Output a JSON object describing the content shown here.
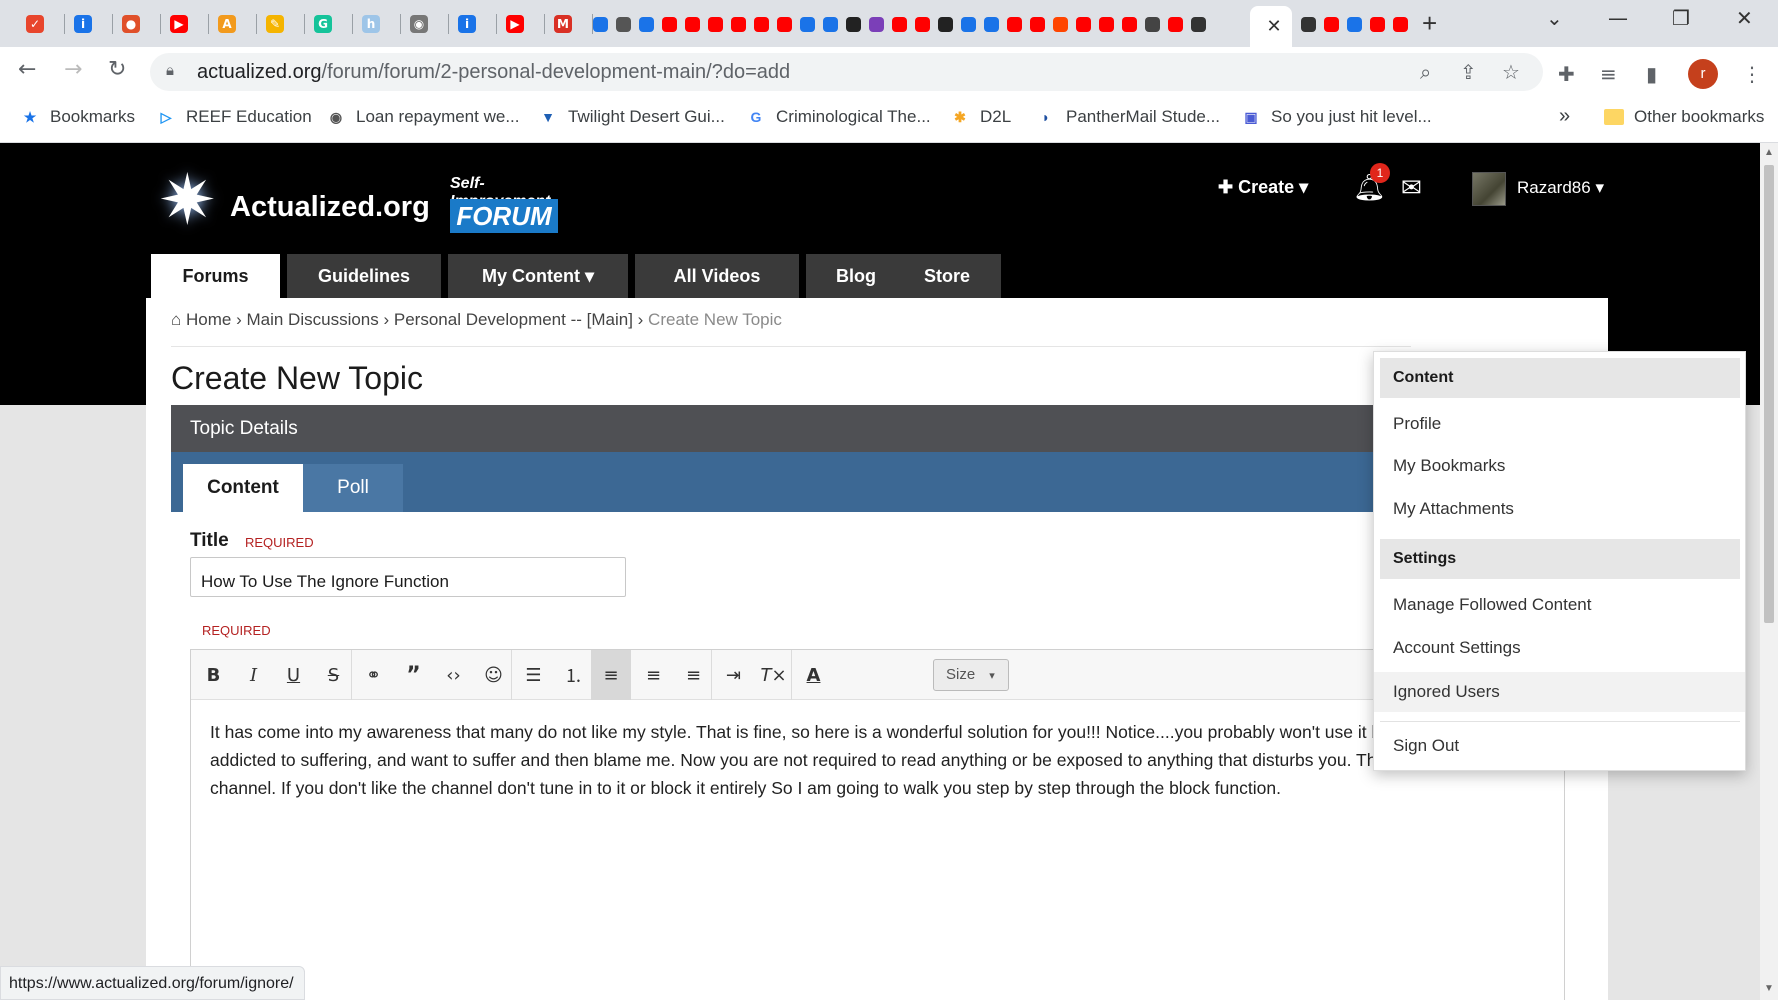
{
  "browser": {
    "tabs": [
      {
        "icon": "scribd-icon",
        "color": "#e8452c",
        "glyph": "✓"
      },
      {
        "icon": "info-icon",
        "color": "#1a73e8",
        "glyph": "i"
      },
      {
        "icon": "podcast-icon",
        "color": "#e0502a",
        "glyph": "●"
      },
      {
        "icon": "youtube-icon",
        "color": "#ff0000",
        "glyph": "▶"
      },
      {
        "icon": "audible-icon",
        "color": "#f29a1d",
        "glyph": "A"
      },
      {
        "icon": "pencil-icon",
        "color": "#f5b400",
        "glyph": "✎"
      },
      {
        "icon": "grammarly-icon",
        "color": "#15c39a",
        "glyph": "G"
      },
      {
        "icon": "hinge-icon",
        "color": "#9ec5e8",
        "glyph": "h"
      },
      {
        "icon": "globe-icon",
        "color": "#777777",
        "glyph": "◉"
      },
      {
        "icon": "info-icon",
        "color": "#1a73e8",
        "glyph": "i"
      },
      {
        "icon": "youtube-icon",
        "color": "#ff0000",
        "glyph": "▶"
      },
      {
        "icon": "gmail-icon",
        "color": "#d93025",
        "glyph": "M"
      }
    ],
    "minitab_colors": [
      "#1a73e8",
      "#555555",
      "#1a73e8",
      "#ff0000",
      "#ff0000",
      "#ff0000",
      "#ff0000",
      "#ff0000",
      "#ff0000",
      "#1a73e8",
      "#1a73e8",
      "#222222",
      "#7b3fb8",
      "#ff0000",
      "#ff0000",
      "#222222",
      "#1a73e8",
      "#1a73e8",
      "#ff0000",
      "#ff0000",
      "#ff4500",
      "#ff0000",
      "#ff0000",
      "#ff0000",
      "#444444",
      "#ff0000",
      "#333333"
    ],
    "active_tab": {
      "icon": "close-icon",
      "glyph": "✕"
    },
    "after_active_colors": [
      "#333333",
      "#ff0000",
      "#1a73e8",
      "#ff0000",
      "#ff0000"
    ],
    "new_tab_glyph": "+",
    "window_controls": {
      "dropdown": "⌄",
      "minimize": "—",
      "restore": "❐",
      "close": "✕"
    },
    "url_host": "actualized.org",
    "url_path": "/forum/forum/2-personal-development-main/?do=add",
    "profile_initial": "r",
    "bookmarks": [
      {
        "label": "Bookmarks",
        "icon": "star-icon",
        "glyph": "★",
        "color": "#1a73e8"
      },
      {
        "label": "REEF Education",
        "icon": "reef-icon",
        "glyph": "▷",
        "color": "#2196f3"
      },
      {
        "label": "Loan repayment we...",
        "icon": "globe-icon",
        "glyph": "◉",
        "color": "#555555"
      },
      {
        "label": "Twilight Desert Gui...",
        "icon": "twilight-icon",
        "glyph": "▼",
        "color": "#1e5fb4"
      },
      {
        "label": "Criminological The...",
        "icon": "google-icon",
        "glyph": "G",
        "color": "#4285f4"
      },
      {
        "label": "D2L",
        "icon": "d2l-icon",
        "glyph": "✱",
        "color": "#f5a623"
      },
      {
        "label": "PantherMail Stude...",
        "icon": "panther-icon",
        "glyph": "◗",
        "color": "#1e4fa0"
      },
      {
        "label": "So you just hit level...",
        "icon": "level-icon",
        "glyph": "▣",
        "color": "#4a5bd4"
      }
    ],
    "bookmarks_overflow": "»",
    "other_bookmarks": "Other bookmarks",
    "status_url": "https://www.actualized.org/forum/ignore/"
  },
  "site": {
    "logo_name": "Actualized.org",
    "logo_tagline": "Self-Improvement",
    "logo_forum": "FORUM",
    "create_label": "Create",
    "notification_count": "1",
    "username": "Razard86",
    "nav_tabs": [
      "Forums",
      "Guidelines",
      "My Content",
      "All Videos",
      "Blog",
      "Store"
    ],
    "breadcrumb": [
      "Home",
      "Main Discussions",
      "Personal Development -- [Main]",
      "Create New Topic"
    ],
    "page_title": "Create New Topic",
    "topic_details": "Topic Details",
    "content_tabs": [
      "Content",
      "Poll"
    ],
    "title_label": "Title",
    "required_label": "REQUIRED",
    "title_value": "How To Use The Ignore Function",
    "size_label": "Size",
    "body_text": "It has come into my awareness that many do not like my style. That is fine, so here is a wonderful solution for you!!! Notice....you probably won't use it because you are addicted to suffering, and want to suffer and then blame me. Now you are not required to read anything or be exposed to anything that disturbs you. Think of my posts as a channel. If you don't like the channel don't tune in to it or block it entirely So I am going to walk you step by step through the block function."
  },
  "user_menu": {
    "content_heading": "Content",
    "content_items": [
      "Profile",
      "My Bookmarks",
      "My Attachments"
    ],
    "settings_heading": "Settings",
    "settings_items": [
      "Manage Followed Content",
      "Account Settings",
      "Ignored Users"
    ],
    "sign_out": "Sign Out"
  }
}
